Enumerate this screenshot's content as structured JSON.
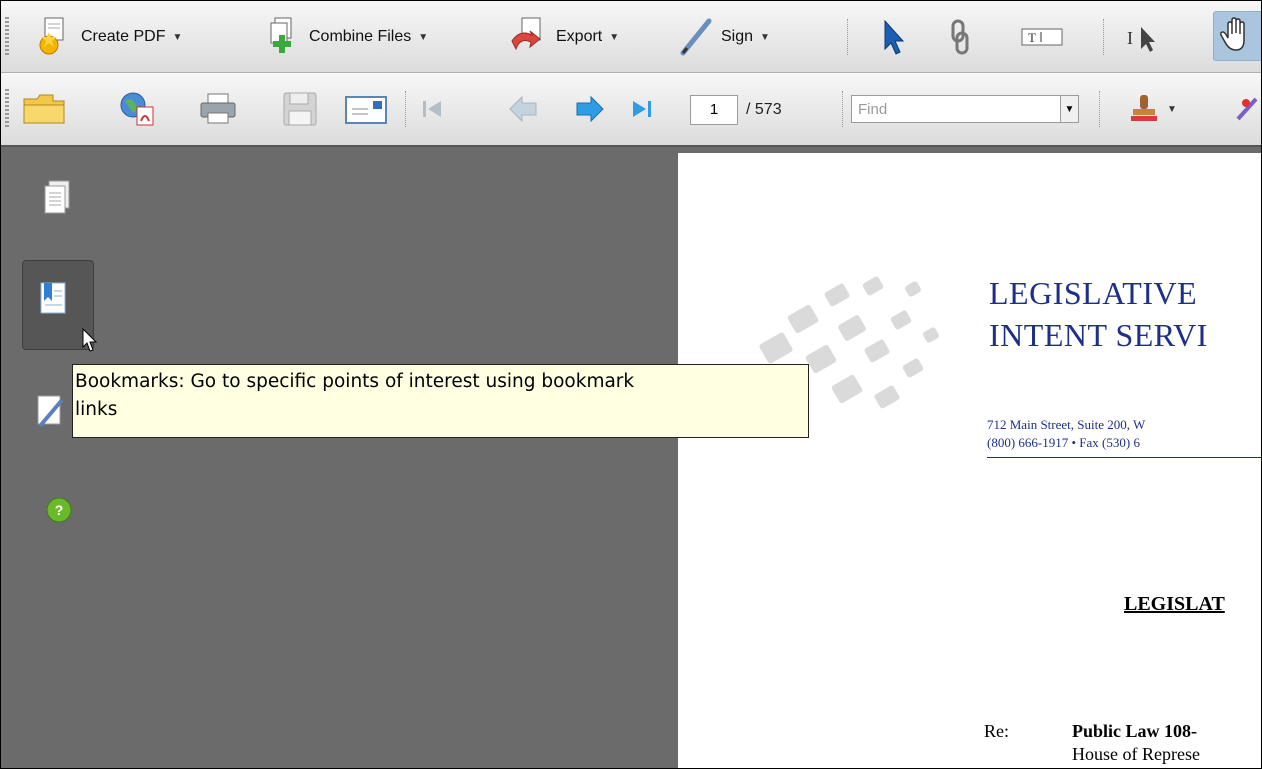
{
  "toolbar1": {
    "create_pdf": "Create PDF",
    "combine_files": "Combine Files",
    "export": "Export",
    "sign": "Sign",
    "tools": [
      "select-arrow-icon",
      "link-icon",
      "text-field-icon",
      "text-select-icon",
      "hand-icon"
    ]
  },
  "toolbar2": {
    "page_current": "1",
    "page_total": "/ 573",
    "find_placeholder": "Find"
  },
  "nav_pane": {
    "icons": [
      "pages-icon",
      "bookmarks-icon",
      "signatures-icon",
      "help-icon"
    ],
    "tooltip_line1": "Bookmarks: Go to specific points of interest using bookmark",
    "tooltip_line2": "links"
  },
  "document": {
    "org_line1": "LEGISLATIVE",
    "org_line2": "INTENT SERVI",
    "address_line1": "712 Main Street, Suite 200, W",
    "address_line2": "(800) 666-1917 • Fax (530) 6",
    "heading": "LEGISLAT",
    "re_label": "Re:",
    "subject_line1": "Public Law 108-",
    "subject_line2": "House of Represe"
  },
  "colors": {
    "nav_pane_bg": "#6b6b6b",
    "tooltip_bg": "#ffffe1",
    "document_blue": "#1e2f8a",
    "hand_tool_active": "#aac6de"
  }
}
